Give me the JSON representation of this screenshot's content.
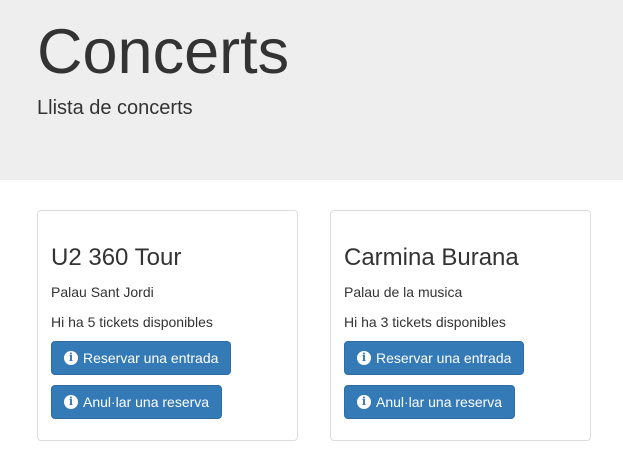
{
  "header": {
    "title": "Concerts",
    "subtitle": "Llista de concerts"
  },
  "concerts": [
    {
      "name": "U2 360 Tour",
      "venue": "Palau Sant Jordi",
      "tickets_text": "Hi ha 5 tickets disponibles",
      "reserve_label": "Reservar una entrada",
      "cancel_label": "Anul·lar una reserva"
    },
    {
      "name": "Carmina Burana",
      "venue": "Palau de la musica",
      "tickets_text": "Hi ha 3 tickets disponibles",
      "reserve_label": "Reservar una entrada",
      "cancel_label": "Anul·lar una reserva"
    }
  ],
  "icons": {
    "info": "info-circle-icon"
  },
  "colors": {
    "jumbotron_bg": "#eeeeee",
    "button_primary": "#337ab7",
    "card_border": "#dddddd"
  }
}
